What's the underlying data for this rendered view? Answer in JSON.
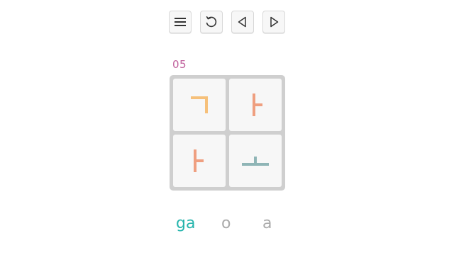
{
  "toolbar": {
    "buttons": [
      {
        "icon": "menu-icon"
      },
      {
        "icon": "restart-icon"
      },
      {
        "icon": "previous-icon"
      },
      {
        "icon": "next-icon"
      }
    ]
  },
  "level": {
    "number": "05",
    "color": "#c0609c"
  },
  "board": {
    "rows": 2,
    "cols": 2,
    "tiles": [
      {
        "jamo": "ㄱ",
        "color": "#f6c07a"
      },
      {
        "jamo": "ㅏ",
        "color": "#ef9f80"
      },
      {
        "jamo": "ㅏ",
        "color": "#ef9f80"
      },
      {
        "jamo": "ㅗ",
        "color": "#8fb5b6"
      }
    ]
  },
  "syllables": {
    "items": [
      "ga",
      "o",
      "a"
    ],
    "active_index": 0,
    "active_color": "#26b5ad",
    "inactive_color": "#aaaaaa"
  }
}
